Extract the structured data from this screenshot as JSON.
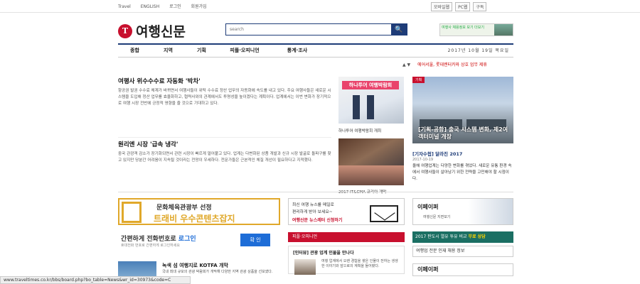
{
  "topbar": {
    "links": [
      "Travel",
      "ENGLISH",
      "로그인",
      "회원가입"
    ],
    "right_buttons": [
      "모바일웹",
      "PC웹",
      "구독"
    ]
  },
  "logo": {
    "mark": "T",
    "text": "여행신문"
  },
  "search": {
    "placeholder": "search"
  },
  "top_ad": {
    "text": "여행사 채용정보 보기 더보기"
  },
  "nav": {
    "items": [
      "종합",
      "지역",
      "기획",
      "피플·오피니언",
      "통계·조사"
    ],
    "date": "2017년 10월 19일 목요일"
  },
  "ticker": {
    "controls": "▲ ▼",
    "text": "에어서울, 롯데렌터카와 상호 업무 제휴"
  },
  "stories": [
    {
      "headline": "여행사 위수수수료 자동화 '박차'",
      "body": "항공권 발권 수수료 체계가 바뀌면서 여행사들이 위탁 수수료 정산 업무의 자동화에 속도를 내고 있다. 주요 여행사들은 새로운 시스템을 도입해 정산 업무를 효율화하고, 협력사와의 관계에서도 투명성을 높이겠다는 계획이다. 업계에서는 이번 변화가 장기적으로 여행 시장 전반에 긍정적 영향을 줄 것으로 기대하고 있다."
    },
    {
      "headline": "원리엔 시장 '급속 냉각'",
      "body": "중국 관광객 감소가 장기화되면서 관련 시장이 빠르게 얼어붙고 있다. 업계는 다변화된 상품 개발과 신규 시장 발굴로 돌파구를 찾고 있지만 당분간 어려움이 지속될 것이라는 전망이 우세하다. 전문가들은 근본적인 체질 개선이 필요하다고 지적했다."
    }
  ],
  "thumbs": [
    {
      "banner": "하나투어 여행박람회",
      "caption": "하나투어 여행박람회 개최"
    },
    {
      "caption": "2017 IT&CMA 코리아 개막"
    }
  ],
  "feature": {
    "tag": "기획",
    "caption": "[기획-공항] 출국 시스템 변화, 제2여객터미널 개장"
  },
  "sub_story": {
    "headline": "[기자수첩] 달라진 2017",
    "date": "2017-10-19",
    "body": "올해 여행업계는 다양한 변화를 겪었다. 새로운 유통 환경 속에서 여행사들이 살아남기 위한 전략을 고민해야 할 시점이다."
  },
  "ads": {
    "culture_line1": "문화체육관광부 선정",
    "culture_line2": "트래비 우수콘텐츠잡지",
    "news_line1": "최신 여행 뉴스를 메일로",
    "news_line2": "편리하게 받아 보세요~",
    "news_cta": "여행신문 뉴스레터 신청하기",
    "epaper_title": "이페이퍼",
    "epaper_sub": "여행신문 지면보기",
    "call_main": "간편하게 전화번호로 ",
    "call_highlight": "로그인",
    "call_sub": "휴대전화 번호로 간편하게 로그인하세요",
    "call_button": "확 인",
    "green_text": "2017 판도시 열유 투유 비교 ",
    "green_highlight": "무료 상담",
    "white_text": "여행업 전문 인재 채용 정보",
    "epaper2_title": "이페이퍼"
  },
  "people": {
    "tab": "피플·오피니언",
    "headline": "[인터뷰] 관광 업계 인물을 만나다",
    "body": "여행 업계에서 오랜 경험을 쌓은 인물이 전하는 생생한 이야기와 앞으로의 계획을 들어봤다."
  },
  "bottom_news": {
    "headline": "녹색 섬 여행지로 KOTFA 개막",
    "body": "국내 최대 규모의 관광 박람회가 개막해 다양한 지역 관광 상품을 선보였다."
  },
  "statusbar": {
    "text": "www.traveltimes.co.kr/bbs/board.php?bo_table=News&wr_id=30973&code=C"
  }
}
